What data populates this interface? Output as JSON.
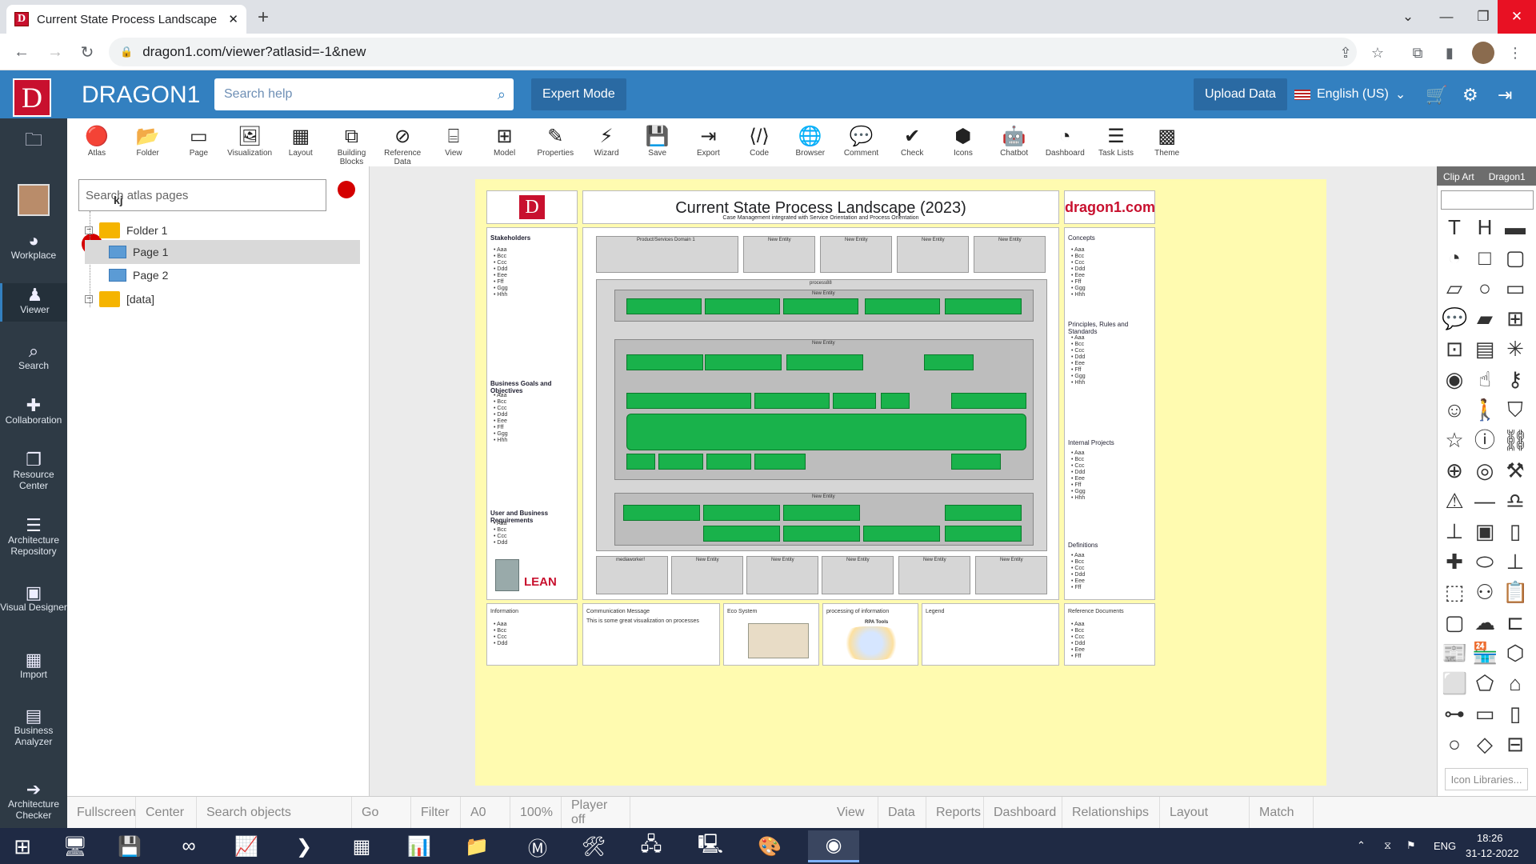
{
  "browser": {
    "tab_title": "Current State Process Landscape",
    "url": "dragon1.com/viewer?atlasid=-1&new"
  },
  "header": {
    "brand": "DRAGON1",
    "help_placeholder": "Search help",
    "expert_mode": "Expert Mode",
    "upload_data": "Upload Data",
    "language": "English (US)"
  },
  "sidebar": [
    {
      "label": "Workplace",
      "icon": "gauge-icon"
    },
    {
      "label": "Viewer",
      "icon": "person-icon"
    },
    {
      "label": "Search",
      "icon": "search-icon"
    },
    {
      "label": "Collaboration",
      "icon": "puzzle-icon"
    },
    {
      "label": "Resource Center",
      "icon": "docs-icon"
    },
    {
      "label": "Architecture Repository",
      "icon": "database-icon"
    },
    {
      "label": "Visual Designer",
      "icon": "image-icon"
    },
    {
      "label": "Import",
      "icon": "grid-icon"
    },
    {
      "label": "Business Analyzer",
      "icon": "chart-icon"
    },
    {
      "label": "Architecture Checker",
      "icon": "arrow-icon"
    }
  ],
  "toolbar": [
    "Atlas",
    "Folder",
    "Page",
    "Visualization",
    "Layout",
    "Building Blocks",
    "Reference Data",
    "View",
    "Model",
    "Properties",
    "Wizard",
    "Save",
    "Export",
    "Code",
    "Browser",
    "Comment",
    "Check",
    "Icons",
    "Chatbot",
    "Dashboard",
    "Task Lists",
    "Theme"
  ],
  "tree": {
    "search_placeholder": "Search atlas pages",
    "root": "kj",
    "folder1": "Folder 1",
    "page1": "Page 1",
    "page2": "Page 2",
    "data": "[data]"
  },
  "canvas": {
    "title": "Current State Process Landscape (2023)",
    "subtitle": "Case Management integrated with Service Orientation and Process Orientation",
    "site": "dragon1.com",
    "lean": "LEAN",
    "left_sections": [
      "Stakeholders",
      "Business Goals and Objectives",
      "User and Business Requirements"
    ],
    "right_sections": [
      "Concepts",
      "Principles, Rules and Standards",
      "Internal Projects",
      "Definitions"
    ],
    "list8": "• Aaa\n• Bcc\n• Ccc\n• Ddd\n• Eee\n• Fff\n• Ggg\n• Hhh",
    "list4": "• Aaa\n• Bcc\n• Ccc\n• Ddd",
    "list7": "• Aaa\n• Bcc\n• Ccc\n• Ddd\n• Eee\n• Fff",
    "bottom": {
      "information": "Information",
      "comm": "Communication Message",
      "comm_text": "This is some great visualization on processes",
      "eco": "Eco System",
      "proc": "processing of information",
      "legend": "Legend",
      "refdocs": "Reference Documents",
      "rpa": "RPA Tools"
    },
    "top_domains": [
      "Product/Services Domain 1",
      "New Entity",
      "New Entity",
      "New Entity",
      "New Entity"
    ],
    "process_label": "process88",
    "new_entity": "New Entity",
    "bottom_domains": [
      "mediaworker!",
      "New Entity",
      "New Entity",
      "New Entity",
      "New Entity",
      "New Entity"
    ]
  },
  "right_panel": {
    "tab1": "Clip Art",
    "tab2": "Dragon1",
    "icon_libraries": "Icon Libraries..."
  },
  "bottom_bar": [
    "Fullscreen",
    "Center",
    "Search objects",
    "Go",
    "Filter",
    "A0",
    "100%",
    "Player off",
    "View",
    "Data",
    "Reports",
    "Dashboard",
    "Relationships",
    "Layout",
    "Match"
  ],
  "taskbar": {
    "lang": "ENG",
    "time": "18:26",
    "date": "31-12-2022"
  }
}
